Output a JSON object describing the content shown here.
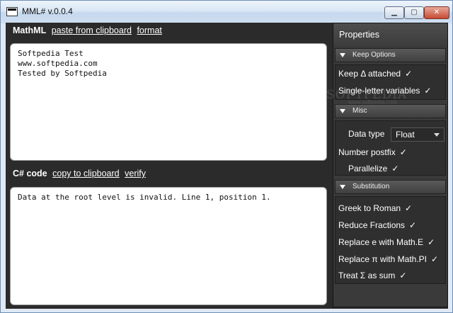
{
  "window": {
    "title": "MML# v.0.0.4",
    "minimize": "▁",
    "maximize": "▢",
    "close": "✕"
  },
  "mathml": {
    "label": "MathML",
    "paste_link": "paste from clipboard",
    "format_link": "format",
    "content": "Softpedia Test\nwww.softpedia.com\nTested by Softpedia"
  },
  "csharp": {
    "label": "C# code",
    "copy_link": "copy to clipboard",
    "verify_link": "verify",
    "content": "Data at the root level is invalid. Line 1, position 1."
  },
  "properties": {
    "title": "Properties",
    "groups": [
      {
        "name": "Keep Options",
        "options": [
          {
            "label": "Keep Δ attached",
            "checked": "✓"
          },
          {
            "label": "Single-letter variables",
            "checked": "✓"
          }
        ]
      },
      {
        "name": "Misc",
        "data_type_label": "Data type",
        "data_type_value": "Float",
        "options": [
          {
            "label": "Number postfix",
            "checked": "✓"
          },
          {
            "label": "Parallelize",
            "checked": "✓"
          }
        ]
      },
      {
        "name": "Substitution",
        "options": [
          {
            "label": "Greek to Roman",
            "checked": "✓"
          },
          {
            "label": "Reduce Fractions",
            "checked": "✓"
          },
          {
            "label": "Replace e with Math.E",
            "checked": "✓"
          },
          {
            "label": "Replace π with Math.PI",
            "checked": "✓"
          },
          {
            "label": "Treat Σ as sum",
            "checked": "✓"
          }
        ]
      }
    ]
  },
  "watermark": {
    "brand": "SOFTPEDIA",
    "url": "www.softpedia.com"
  }
}
